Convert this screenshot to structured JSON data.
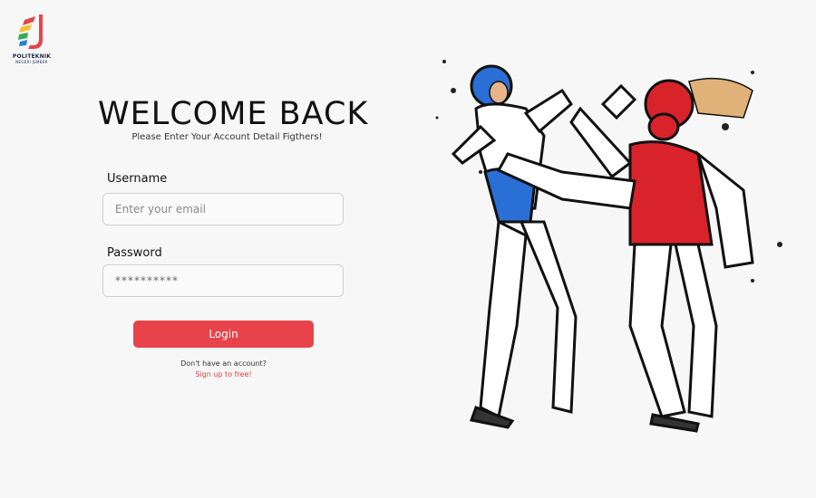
{
  "brand": {
    "line1": "POLITEKNIK",
    "line2": "NEGERI JEMBER",
    "colors": {
      "navy": "#1b2a4a",
      "red": "#e8434a",
      "yellow": "#f2c12e",
      "green": "#3aa856",
      "blue": "#2a7fd4"
    }
  },
  "login": {
    "title": "WELCOME BACK",
    "subtitle": "Please Enter Your Account Detail Figthers!",
    "username_label": "Username",
    "username_placeholder": "Enter your email",
    "password_label": "Password",
    "password_value": "**********",
    "button_label": "Login",
    "no_account_text": "Don't have an account?",
    "signup_link": "Sign up to free!"
  },
  "illustration": {
    "icon": "taekwondo-fighters-illustration",
    "colors": {
      "blue_fighter": "#2a6fd6",
      "red_fighter": "#d8232b"
    }
  },
  "theme": {
    "accent": "#e8434a",
    "background": "#f7f7f7"
  }
}
